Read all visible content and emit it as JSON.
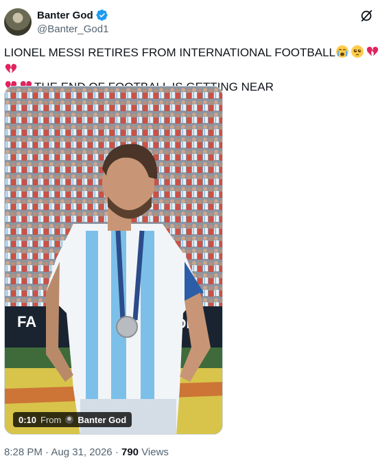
{
  "author": {
    "display_name": "Banter God",
    "handle": "@Banter_God1",
    "verified": true
  },
  "tweet": {
    "line1": "LIONEL MESSI RETIRES FROM INTERNATIONAL FOOTBALL",
    "line2": "THE END OF FOOTBALL IS GETTING NEAR",
    "emojis_line1": [
      "loudly-crying-face",
      "pleading-face",
      "broken-heart",
      "broken-heart"
    ],
    "emojis_line2": [
      "broken-heart",
      "broken-heart"
    ]
  },
  "media": {
    "type": "video",
    "duration": "0:10",
    "from_label": "From",
    "from_author": "Banter God",
    "background_text": "FA",
    "background_text2": "DE"
  },
  "meta": {
    "time": "8:28 PM",
    "separator": "·",
    "date": "Aug 31, 2026",
    "views_count": "790",
    "views_label": "Views"
  },
  "colors": {
    "text": "#0f1419",
    "secondary": "#536471",
    "verified_blue": "#1d9bf0",
    "broken_heart": "#e0245e"
  },
  "icons": {
    "verified": "verified-badge-icon",
    "grok": "grok-icon"
  }
}
